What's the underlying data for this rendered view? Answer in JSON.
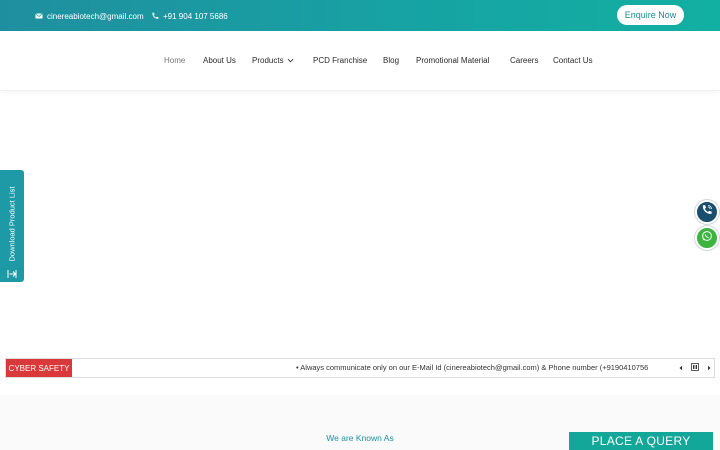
{
  "topbar": {
    "email": "cinereabiotech@gmail.com",
    "phone": "+91 904 107 5686",
    "enquire_label": "Enquire Now"
  },
  "nav": {
    "items": [
      {
        "label": "Home"
      },
      {
        "label": "About Us"
      },
      {
        "label": "Products"
      },
      {
        "label": "PCD Franchise"
      },
      {
        "label": "Blog"
      },
      {
        "label": "Promotional Material"
      },
      {
        "label": "Careers"
      },
      {
        "label": "Contact Us"
      }
    ]
  },
  "side_tab": {
    "label": "Download Product List"
  },
  "ticker": {
    "badge": "CYBER SAFETY",
    "text": "•  Always communicate only on our E-Mail Id (cinereabiotech@gmail.com) & Phone number (+9190410756"
  },
  "section": {
    "known_label": "We are Known As"
  },
  "place_query_label": "PLACE A QUERY",
  "colors": {
    "topbar": "#17a2a3",
    "accent": "#1d9aa6",
    "badge": "#d9393a",
    "whatsapp": "#3db43f",
    "phone_button": "#1a4e6e"
  },
  "icons": [
    "envelope-icon",
    "phone-icon",
    "chevron-down-icon",
    "download-icon",
    "phone-call-icon",
    "whatsapp-icon",
    "arrow-left-icon",
    "pause-icon",
    "arrow-right-icon"
  ]
}
